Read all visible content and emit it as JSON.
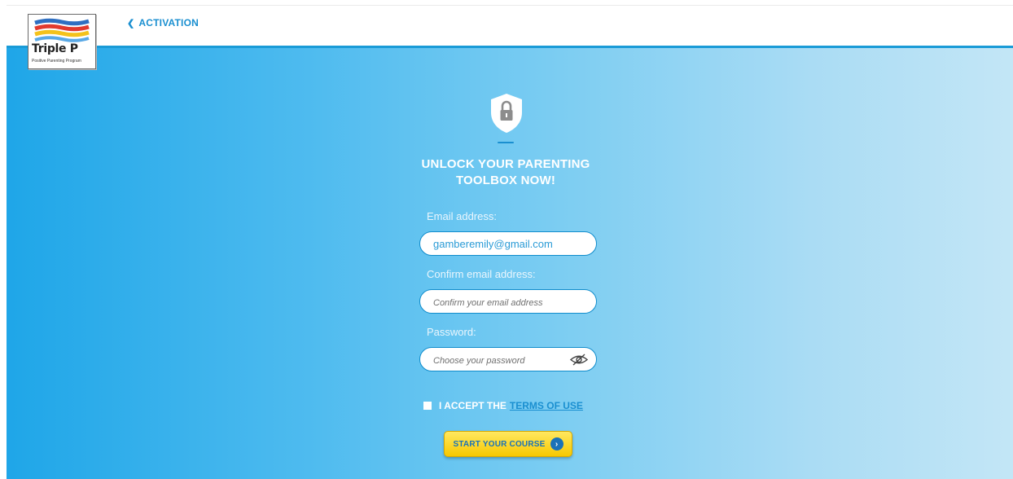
{
  "header": {
    "back_label": "ACTIVATION",
    "logo": {
      "title": "Triple P",
      "subtitle": "Positive Parenting Program"
    }
  },
  "form": {
    "heading_line1": "UNLOCK YOUR PARENTING",
    "heading_line2": "TOOLBOX NOW!",
    "email": {
      "label": "Email address:",
      "value": "gamberemily@gmail.com"
    },
    "confirm_email": {
      "label": "Confirm email address:",
      "placeholder": "Confirm your email address",
      "value": ""
    },
    "password": {
      "label": "Password:",
      "placeholder": "Choose your password",
      "value": ""
    },
    "terms": {
      "prefix": "I ACCEPT THE",
      "link": "TERMS OF USE",
      "checked": false
    },
    "submit_label": "START YOUR COURSE"
  },
  "icons": {
    "back": "chevron-left-icon",
    "shield": "shield-lock-icon",
    "password_toggle": "eye-slash-icon",
    "submit": "arrow-right-circle-icon"
  },
  "colors": {
    "brand_blue": "#1a8fd0",
    "hero_left": "#1fa6e8",
    "hero_right": "#c3e6f6",
    "button_yellow": "#f7c800"
  }
}
